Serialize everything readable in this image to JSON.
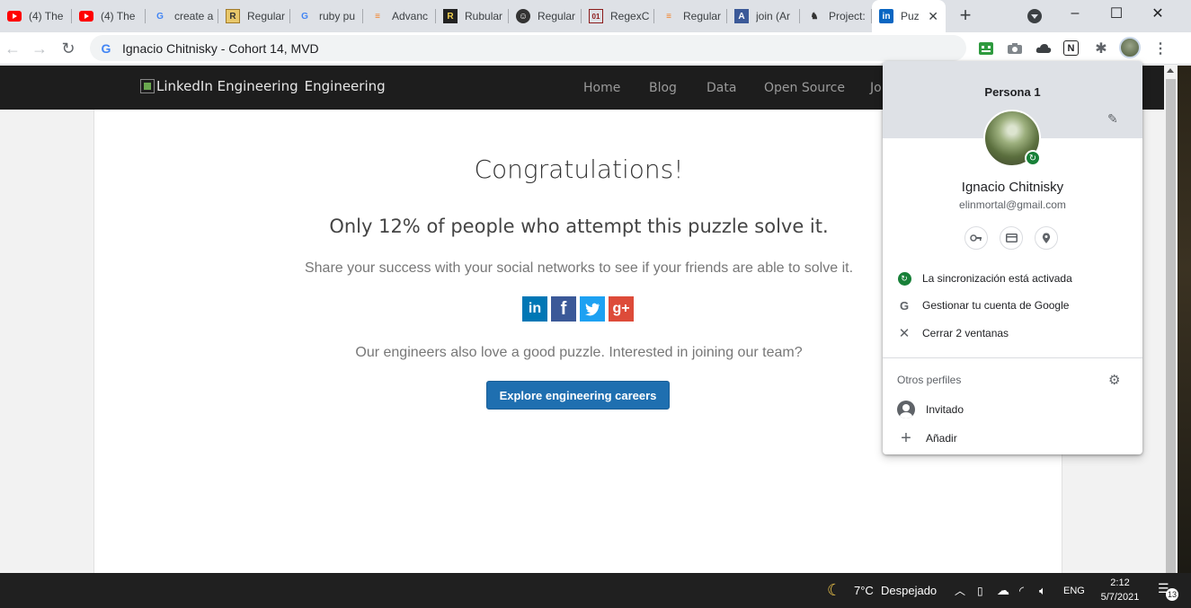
{
  "browser": {
    "tabs": [
      {
        "title": "(4) The",
        "icon": "youtube-icon",
        "color": "#ff0000"
      },
      {
        "title": "(4) The",
        "icon": "youtube-icon",
        "color": "#ff0000"
      },
      {
        "title": "create a",
        "icon": "google-icon",
        "color": "#4285f4"
      },
      {
        "title": "Regular",
        "icon": "regex-icon",
        "color": "#c8a04a"
      },
      {
        "title": "ruby pu",
        "icon": "google-icon",
        "color": "#4285f4"
      },
      {
        "title": "Advanc",
        "icon": "stackoverflow-icon",
        "color": "#f48024"
      },
      {
        "title": "Rubular",
        "icon": "rubular-icon",
        "color": "#000000"
      },
      {
        "title": "Regular",
        "icon": "github-icon",
        "color": "#000000"
      },
      {
        "title": "RegexC",
        "icon": "regexone-icon",
        "color": "#8b1a1a"
      },
      {
        "title": "Regular",
        "icon": "stackoverflow-icon",
        "color": "#f48024"
      },
      {
        "title": "join (Ar",
        "icon": "appacademy-icon",
        "color": "#3b5998"
      },
      {
        "title": "Project:",
        "icon": "figure-icon",
        "color": "#333333"
      },
      {
        "title": "Puz",
        "icon": "linkedin-icon",
        "color": "#0a66c2",
        "active": true
      }
    ],
    "address": "Ignacio Chitnisky - Cohort 14, MVD"
  },
  "site": {
    "logo_alt": "LinkedIn Engineering",
    "logo_text": "Engineering",
    "nav": [
      "Home",
      "Blog",
      "Data",
      "Open Source",
      "Jo"
    ]
  },
  "content": {
    "heading": "Congratulations!",
    "subheading": "Only 12% of people who attempt this puzzle solve it.",
    "share_text": "Share your success with your social networks to see if your friends are able to solve it.",
    "socials": [
      {
        "name": "linkedin",
        "glyph": "in",
        "color": "#0077b5"
      },
      {
        "name": "facebook",
        "glyph": "f",
        "color": "#3b5998"
      },
      {
        "name": "twitter",
        "glyph": "t",
        "color": "#1da1f2"
      },
      {
        "name": "googleplus",
        "glyph": "g+",
        "color": "#dd4b39"
      }
    ],
    "join_text": "Our engineers also love a good puzzle. Interested in joining our team?",
    "cta_label": "Explore engineering careers"
  },
  "profile_popup": {
    "title": "Persona 1",
    "name": "Ignacio Chitnisky",
    "email": "elinmortal@gmail.com",
    "quick_icons": [
      "key-icon",
      "card-icon",
      "location-icon"
    ],
    "sync_label": "La sincronización está activada",
    "manage_label": "Gestionar tu cuenta de Google",
    "close_label": "Cerrar 2 ventanas",
    "others_label": "Otros perfiles",
    "guest_label": "Invitado",
    "add_label": "Añadir"
  },
  "taskbar": {
    "weather_temp": "7°C",
    "weather_desc": "Despejado",
    "lang": "ENG",
    "time": "2:12",
    "date": "5/7/2021",
    "notifications": "13"
  }
}
